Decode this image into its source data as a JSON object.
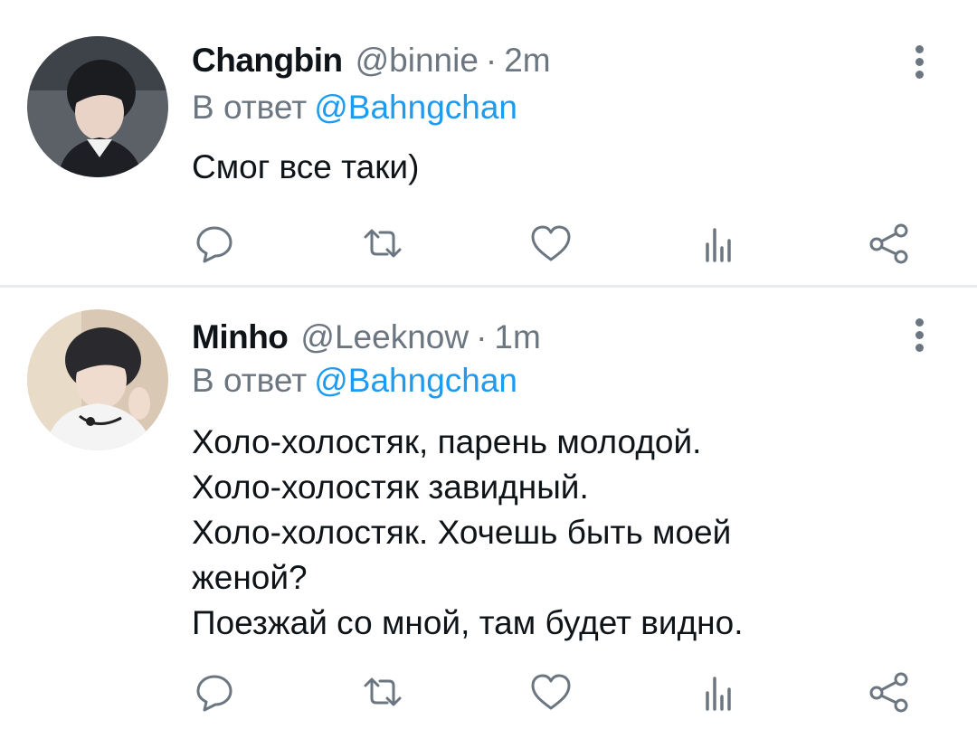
{
  "tweets": [
    {
      "author_name": "Changbin",
      "handle": "@binnie",
      "separator": "·",
      "time": "2m",
      "reply_prefix": "В ответ",
      "reply_to": "@Bahngchan",
      "text_lines": [
        "Смог все таки)"
      ],
      "actions": [
        "reply-icon",
        "retweet-icon",
        "like-icon",
        "analytics-icon",
        "share-icon"
      ]
    },
    {
      "author_name": "Minho",
      "handle": "@Leeknow",
      "separator": "·",
      "time": "1m",
      "reply_prefix": "В ответ",
      "reply_to": "@Bahngchan",
      "text_lines": [
        "Холо-холостяк, парень молодой.",
        "Холо-холостяк завидный.",
        "Холо-холостяк. Хочешь быть моей",
        "женой?",
        "Поезжай со мной, там будет видно."
      ],
      "actions": [
        "reply-icon",
        "retweet-icon",
        "like-icon",
        "analytics-icon",
        "share-icon"
      ]
    }
  ],
  "colors": {
    "mention": "#1d9bf0",
    "secondary_text": "#6b7680",
    "primary_text": "#0f1419",
    "icon": "#6b7680",
    "divider": "#e9ecee"
  }
}
